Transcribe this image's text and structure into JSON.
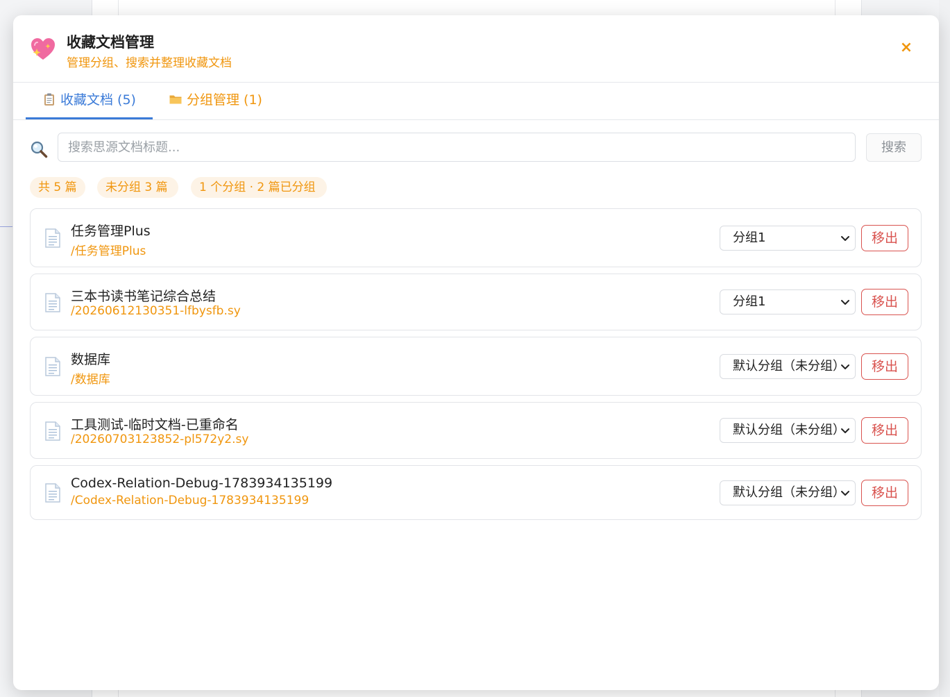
{
  "header": {
    "title": "收藏文档管理",
    "subtitle": "管理分组、搜索并整理收藏文档",
    "close_label": "×"
  },
  "tabs": [
    {
      "label": "收藏文档 (5)",
      "icon": "clipboard-icon",
      "active": true
    },
    {
      "label": "分组管理 (1)",
      "icon": "folder-icon",
      "active": false
    }
  ],
  "search": {
    "placeholder": "搜索思源文档标题...",
    "button_label": "搜索"
  },
  "stats": {
    "total": "共 5 篇",
    "ungrouped": "未分组 3 篇",
    "grouped": "1 个分组 · 2 篇已分组"
  },
  "docs": [
    {
      "title": "任务管理Plus",
      "path": "/任务管理Plus",
      "group": "分组1",
      "remove_label": "移出"
    },
    {
      "title": "三本书读书笔记综合总结",
      "path": "/20260612130351-lfbysfb.sy",
      "group": "分组1",
      "remove_label": "移出"
    },
    {
      "title": "数据库",
      "path": "/数据库",
      "group": "默认分组（未分组）",
      "remove_label": "移出"
    },
    {
      "title": "工具测试-临时文档-已重命名",
      "path": "/20260703123852-pl572y2.sy",
      "group": "默认分组（未分组）",
      "remove_label": "移出"
    },
    {
      "title": "Codex-Relation-Debug-1783934135199",
      "path": "/Codex-Relation-Debug-1783934135199",
      "group": "默认分组（未分组）",
      "remove_label": "移出"
    }
  ],
  "colors": {
    "accent": "#3b7bd8",
    "orange": "#f0960e",
    "danger": "#d9534f"
  }
}
